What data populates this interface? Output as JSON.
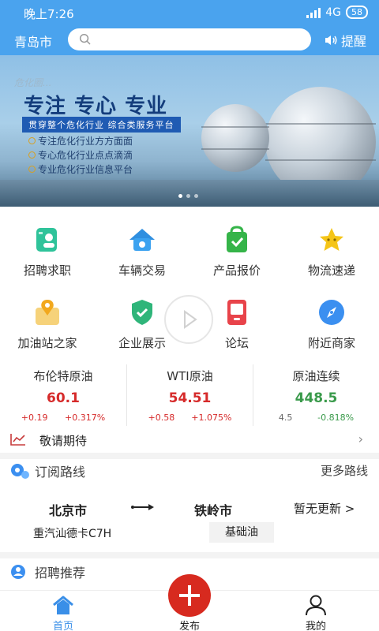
{
  "status": {
    "time": "晚上7:26",
    "network": "4G",
    "battery": "58"
  },
  "header": {
    "city": "青岛市",
    "search_placeholder": "",
    "remind": "提醒"
  },
  "banner": {
    "watermark": "危化圈...",
    "headline": "专注 专心 专业",
    "ribbon": "贯穿整个危化行业  综合类服务平台",
    "bullets": [
      "专注危化行业方方面面",
      "专心危化行业点点滴滴",
      "专业危化行业信息平台"
    ]
  },
  "grid": [
    {
      "label": "招聘求职",
      "icon": "recruit-icon"
    },
    {
      "label": "车辆交易",
      "icon": "vehicle-trade-icon"
    },
    {
      "label": "产品报价",
      "icon": "product-quote-icon"
    },
    {
      "label": "物流速递",
      "icon": "logistics-icon"
    },
    {
      "label": "加油站之家",
      "icon": "gas-station-icon"
    },
    {
      "label": "企业展示",
      "icon": "enterprise-icon"
    },
    {
      "label": "论坛",
      "icon": "forum-icon"
    },
    {
      "label": "附近商家",
      "icon": "nearby-merchant-icon"
    }
  ],
  "markets": [
    {
      "name": "布伦特原油",
      "value": "60.1",
      "change": "+0.19",
      "pct": "+0.317%",
      "color": "#d62a2a"
    },
    {
      "name": "WTI原油",
      "value": "54.51",
      "change": "+0.58",
      "pct": "+1.075%",
      "color": "#d62a2a"
    },
    {
      "name": "原油连续",
      "value": "448.5",
      "change": "4.5",
      "pct": "-0.818%",
      "color": "#3a9a4b"
    }
  ],
  "notice": {
    "text": "敬请期待",
    "arrow": "›"
  },
  "subscribe": {
    "title": "订阅路线",
    "more": "更多路线"
  },
  "route": {
    "from": "北京市",
    "to": "铁岭市",
    "update": "暂无更新 >",
    "truck": "重汽汕德卡C7H",
    "cargo": "基础油"
  },
  "recruit": {
    "title": "招聘推荐"
  },
  "tabs": {
    "home": "首页",
    "publish": "发布",
    "mine": "我的"
  },
  "colors": {
    "primary": "#4aa3ee",
    "accent_red": "#d72a1f"
  }
}
